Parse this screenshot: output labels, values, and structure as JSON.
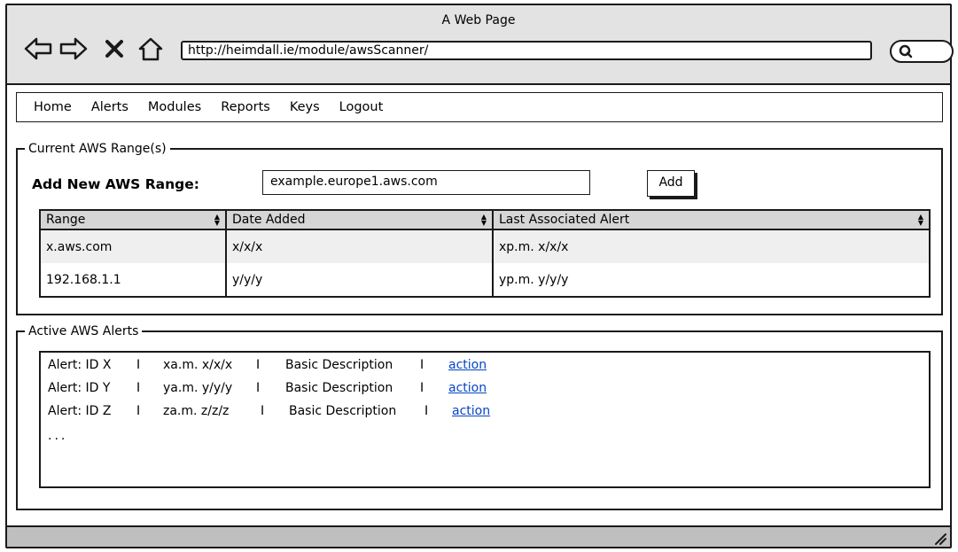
{
  "window": {
    "title": "A Web Page"
  },
  "address_bar": {
    "url": "http://heimdall.ie/module/awsScanner/"
  },
  "icons": {
    "back": "back-arrow-icon",
    "forward": "forward-arrow-icon",
    "stop": "close-icon",
    "home": "home-icon",
    "search": "search-icon",
    "resize": "resize-grip-icon"
  },
  "menu": [
    "Home",
    "Alerts",
    "Modules",
    "Reports",
    "Keys",
    "Logout"
  ],
  "ranges": {
    "legend": "Current AWS Range(s)",
    "add_label": "Add New AWS Range:",
    "input_value": "example.europe1.aws.com",
    "add_button": "Add",
    "columns": [
      "Range",
      "Date Added",
      "Last Associated Alert"
    ],
    "rows": [
      [
        "x.aws.com",
        "x/x/x",
        "xp.m. x/x/x"
      ],
      [
        "192.168.1.1",
        "y/y/y",
        "yp.m. y/y/y"
      ]
    ]
  },
  "alerts": {
    "legend": "Active AWS Alerts",
    "rows": [
      {
        "id": "Alert: ID X",
        "time": "xa.m. x/x/x",
        "desc": "Basic Description",
        "action": "action"
      },
      {
        "id": "Alert: ID Y",
        "time": "ya.m. y/y/y",
        "desc": "Basic Description",
        "action": "action"
      },
      {
        "id": "Alert: ID Z",
        "time": "za.m. z/z/z",
        "desc": "Basic Description",
        "action": "action"
      }
    ],
    "separator": "I",
    "more": "..."
  },
  "colors": {
    "chrome": "#e3e3e3",
    "header_cell": "#d6d6d6",
    "alt_row": "#efefef",
    "link": "#0645c8",
    "status_bar": "#bfbfbf"
  }
}
